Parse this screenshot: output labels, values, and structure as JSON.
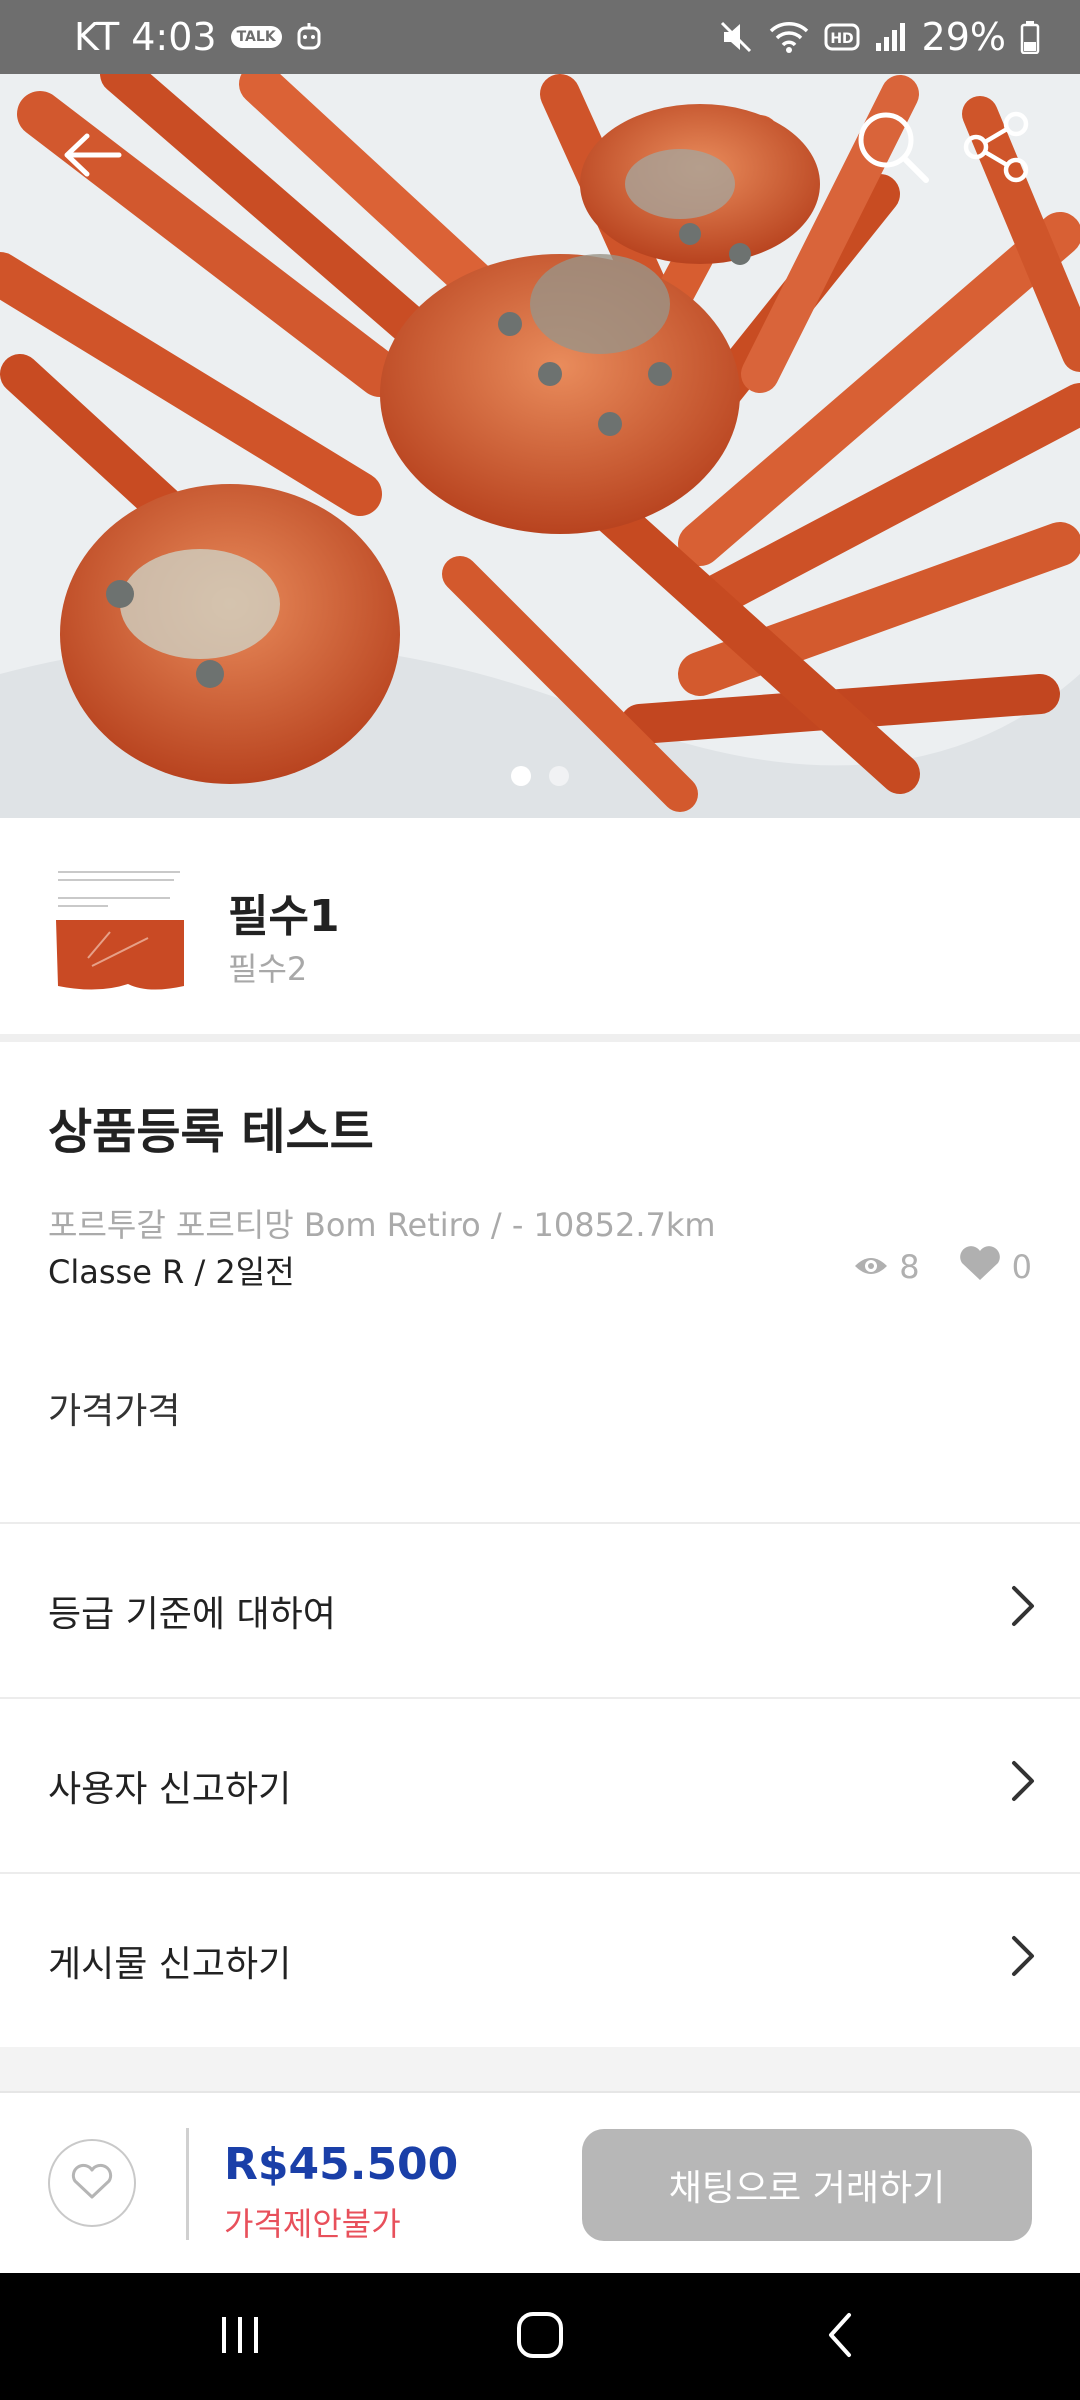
{
  "status_bar": {
    "carrier_time": "KT 4:03",
    "talk_badge": "TALK",
    "battery": "29%",
    "icons": [
      "kakaotalk-icon",
      "robot-icon",
      "mute-icon",
      "wifi-icon",
      "hd-icon",
      "signal-icon",
      "battery-icon"
    ]
  },
  "hero": {
    "image_description_icon": "crab-photo",
    "page_count": 2,
    "active_page": 1,
    "icons": [
      "back-arrow-icon",
      "search-icon",
      "share-icon"
    ]
  },
  "seller": {
    "name": "필수1",
    "subtitle": "필수2"
  },
  "product": {
    "title": "상품등록 테스트",
    "location": "포르투갈 포르티망 Bom Retiro / - 10852.7km",
    "meta": "Classe R / 2일전",
    "views": "8",
    "likes": "0",
    "description": "가격가격"
  },
  "menu": [
    {
      "label": "등급 기준에 대하여"
    },
    {
      "label": "사용자 신고하기"
    },
    {
      "label": "게시물 신고하기"
    }
  ],
  "action_bar": {
    "price": "R$45.500",
    "price_note": "가격제안불가",
    "chat_button": "채팅으로 거래하기"
  },
  "colors": {
    "price": "#1a3fa8",
    "price_note": "#e8505b",
    "chat_button_bg": "#b7b7b7",
    "status_bar_bg": "#6e6e6e"
  }
}
